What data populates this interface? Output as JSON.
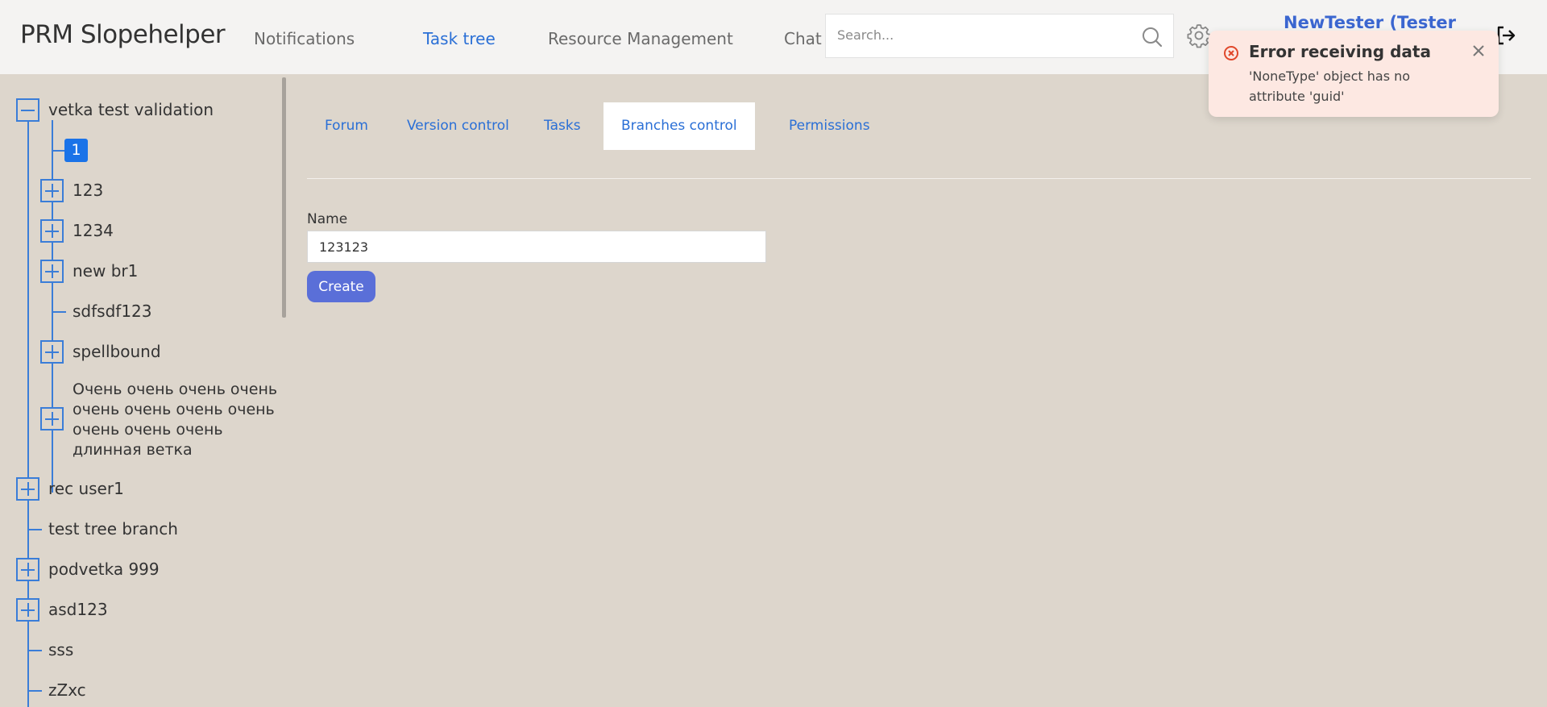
{
  "app": {
    "title": "PRM Slopehelper"
  },
  "nav": {
    "items": [
      {
        "label": "Notifications",
        "active": false
      },
      {
        "label": "Task tree",
        "active": true
      },
      {
        "label": "Resource Management",
        "active": false
      },
      {
        "label": "Chat",
        "active": false
      }
    ]
  },
  "search": {
    "placeholder": "Search...",
    "value": ""
  },
  "user": {
    "name": "NewTester (Tester"
  },
  "toast": {
    "title": "Error receiving data",
    "message": "'NoneType' object has no attribute 'guid'"
  },
  "tree": {
    "root": {
      "label": "vetka test validation",
      "expanded": true
    },
    "selected": "1",
    "children": [
      {
        "label": "123",
        "expandable": true
      },
      {
        "label": "1234",
        "expandable": true
      },
      {
        "label": "new br1",
        "expandable": true
      },
      {
        "label": "sdfsdf123",
        "expandable": false
      },
      {
        "label": "spellbound",
        "expandable": true
      },
      {
        "label": "Очень очень очень очень очень очень очень очень очень очень очень длинная ветка",
        "expandable": true
      }
    ],
    "siblings": [
      {
        "label": "rec user1",
        "expandable": true
      },
      {
        "label": "test tree branch",
        "expandable": false
      },
      {
        "label": "podvetka 999",
        "expandable": true
      },
      {
        "label": "asd123",
        "expandable": true
      },
      {
        "label": "sss",
        "expandable": false
      },
      {
        "label": "zZxc",
        "expandable": false
      }
    ]
  },
  "tabs": [
    {
      "label": "Forum",
      "active": false
    },
    {
      "label": "Version control",
      "active": false
    },
    {
      "label": "Tasks",
      "active": false
    },
    {
      "label": "Branches control",
      "active": true
    },
    {
      "label": "Permissions",
      "active": false
    }
  ],
  "form": {
    "name_label": "Name",
    "name_value": "123123",
    "create_label": "Create"
  },
  "colors": {
    "accent": "#2a6fd6",
    "button": "#5a6fd8",
    "background": "#ddd6cc",
    "toast": "#fde8e2",
    "error": "#e0472a"
  }
}
